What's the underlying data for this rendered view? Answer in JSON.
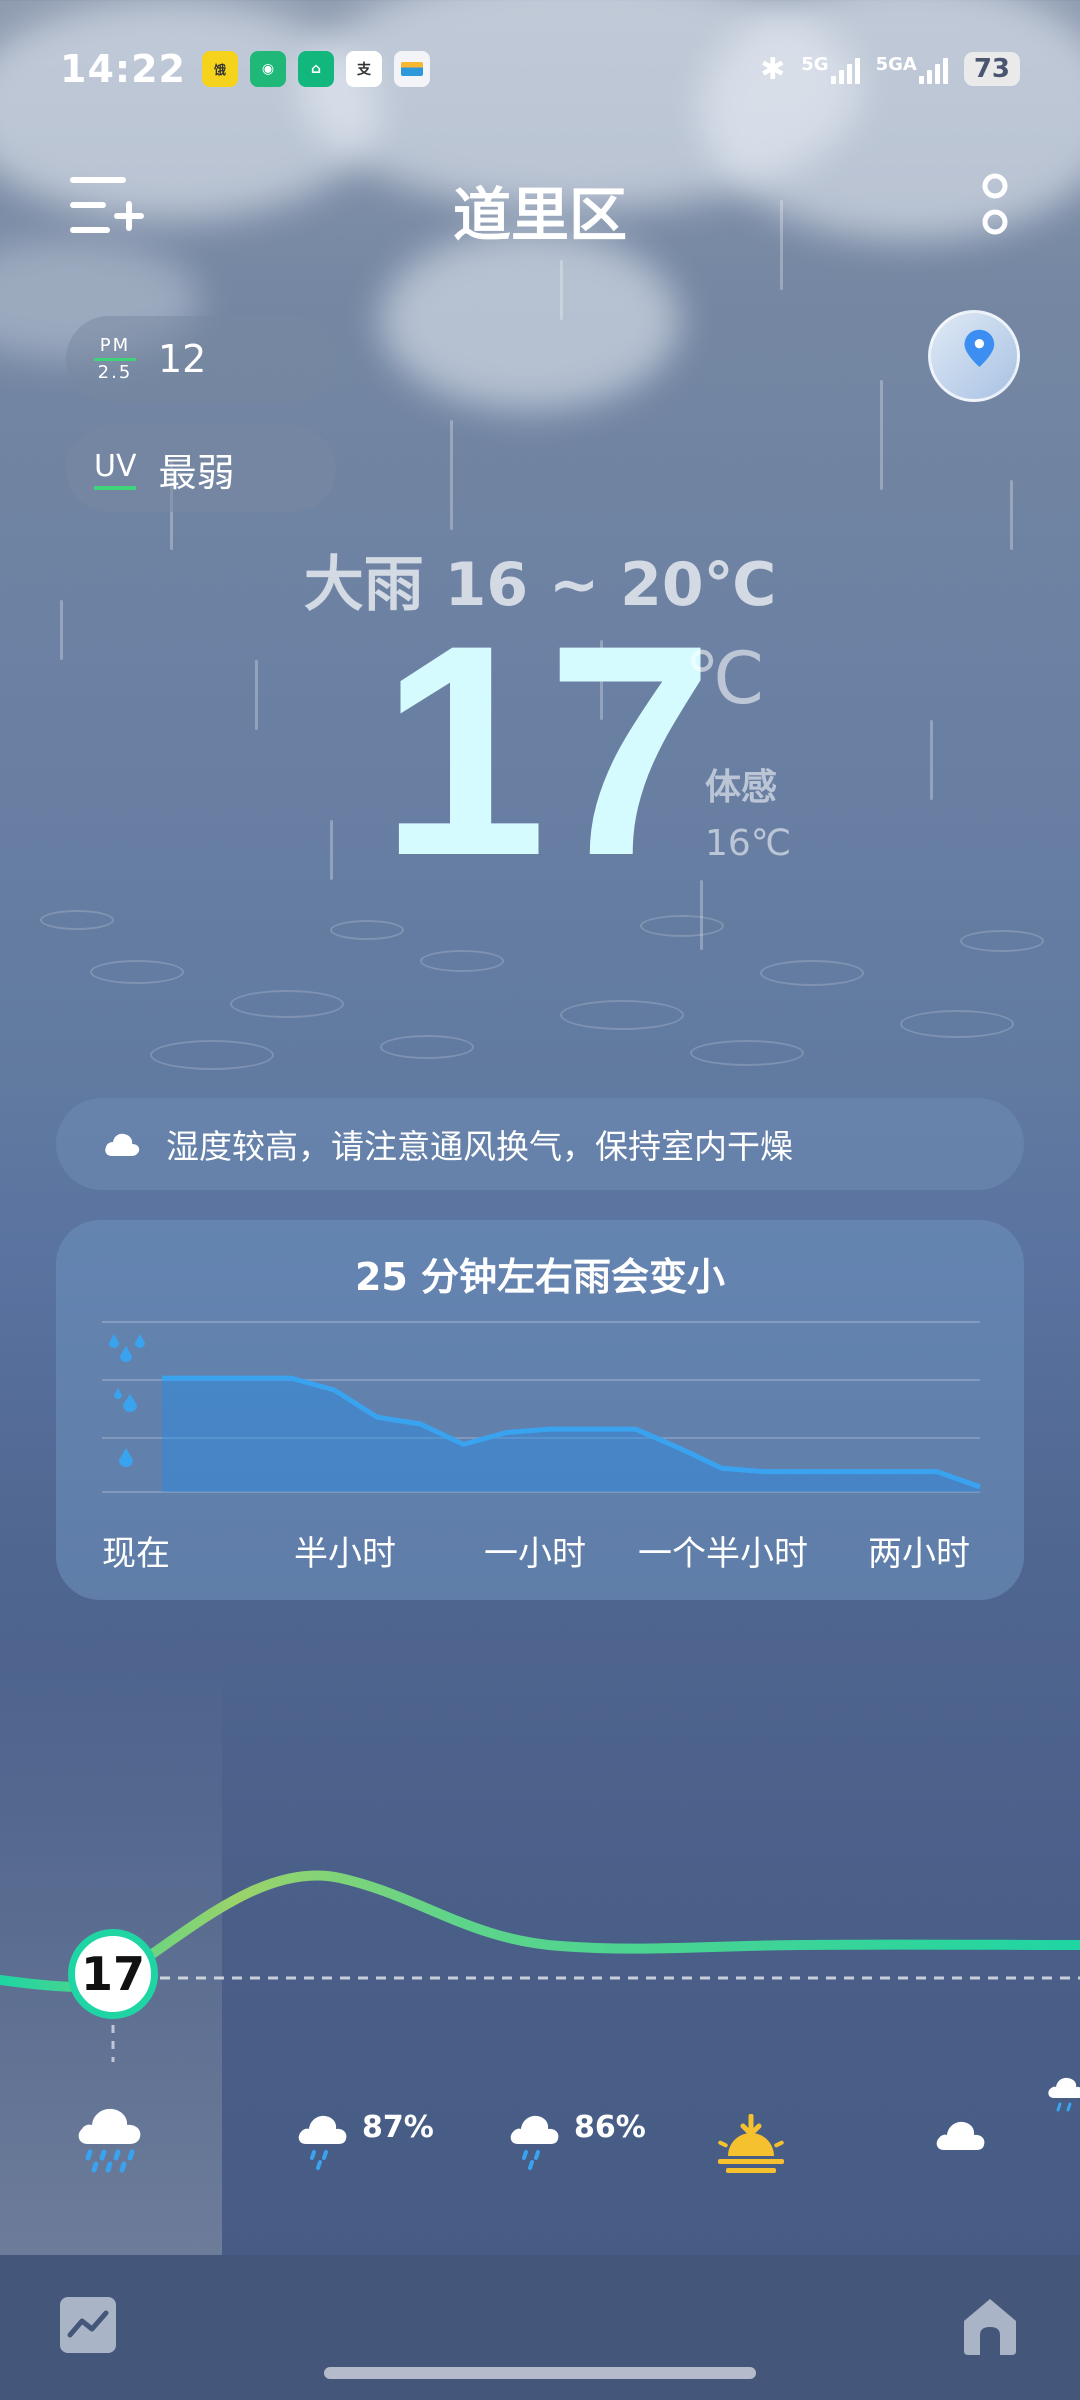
{
  "status_bar": {
    "time": "14:22",
    "app_icons": [
      "饿了么-icon",
      "cat-icon",
      "housing-icon",
      "alipay-icon",
      "wallet-icon"
    ],
    "network_1": "5G",
    "network_2": "5GA",
    "battery": "73"
  },
  "header": {
    "city": "道里区"
  },
  "air": {
    "pm_label_top": "PM",
    "pm_label_bottom": "2.5",
    "pm_value": "12",
    "uv_label": "UV",
    "uv_value": "最弱"
  },
  "current": {
    "condition": "大雨  16 ~ 20℃",
    "temperature": "17",
    "unit": "℃",
    "feels_label": "体感",
    "feels_value": "16℃"
  },
  "tip": {
    "text": "湿度较高，请注意通风换气，保持室内干燥"
  },
  "rain_card": {
    "title": "25 分钟左右雨会变小",
    "x_labels": [
      "现在",
      "半小时",
      "一小时",
      "一个半小时",
      "两小时"
    ]
  },
  "chart_data": {
    "type": "area",
    "title": "25 分钟左右雨会变小",
    "categories": [
      "现在",
      "半小时",
      "一小时",
      "一个半小时",
      "两小时"
    ],
    "series": [
      {
        "values": [
          0.67,
          0.67,
          0.67,
          0.67,
          0.6,
          0.44,
          0.4,
          0.28,
          0.35,
          0.37,
          0.37,
          0.37,
          0.26,
          0.14,
          0.12,
          0.12,
          0.12,
          0.12,
          0.12,
          0.03
        ]
      }
    ],
    "ylim": [
      0,
      1
    ],
    "grid": true
  },
  "forecast": {
    "current_temp": "17",
    "items": [
      {
        "icon": "heavy-rain-icon",
        "pct": ""
      },
      {
        "icon": "rain-icon",
        "pct": "87%"
      },
      {
        "icon": "rain-icon",
        "pct": "86%"
      },
      {
        "icon": "sunset-icon",
        "pct": ""
      },
      {
        "icon": "cloud-icon",
        "pct": ""
      }
    ]
  },
  "colors": {
    "accent_green": "#1ed5a3",
    "rain_blue": "#3aa3f0",
    "sun_yellow": "#f6c12f"
  }
}
